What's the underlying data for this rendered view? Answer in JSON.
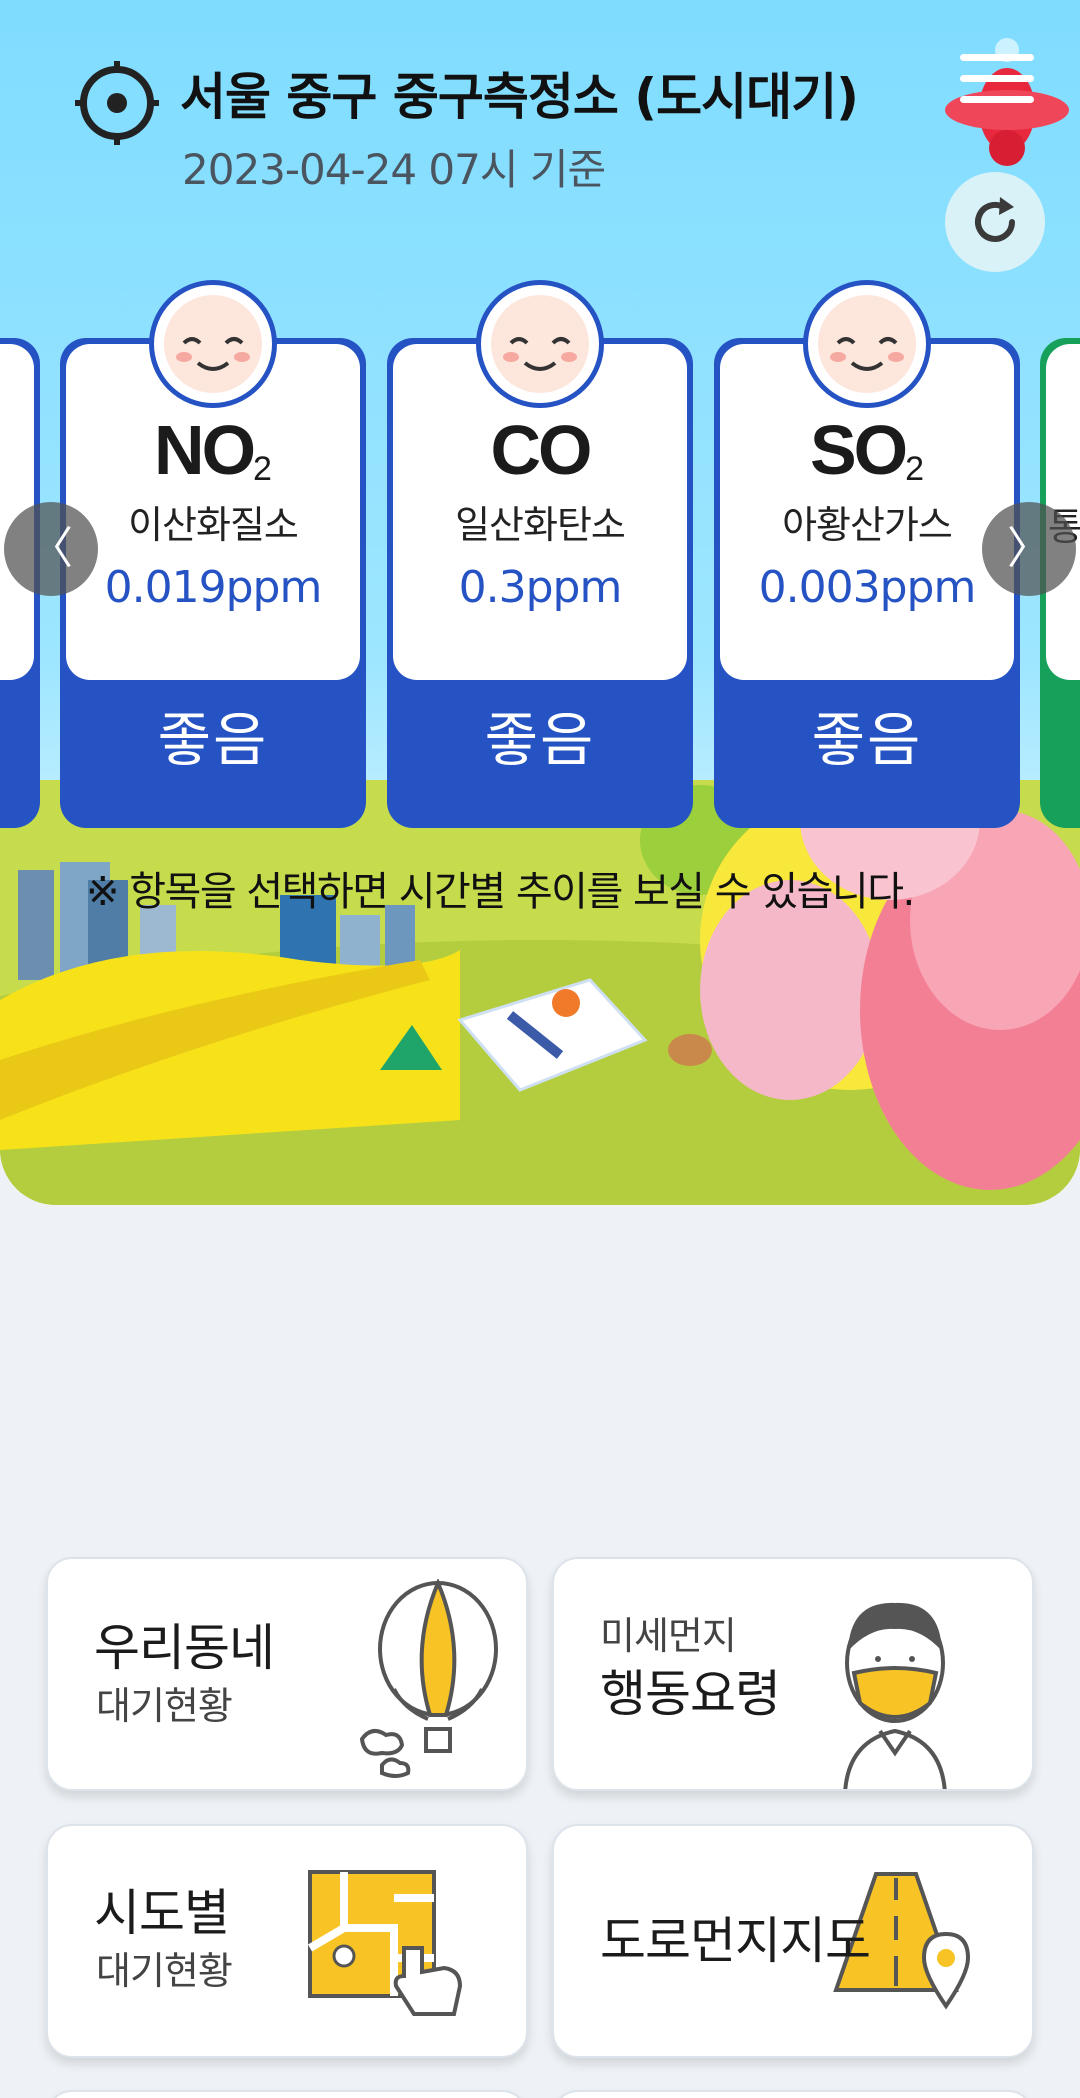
{
  "header": {
    "station_title": "서울 중구 중구측정소 (도시대기)",
    "timestamp": "2023-04-24 07시 기준"
  },
  "icons": {
    "location": "crosshair-icon",
    "menu": "hamburger-menu-icon",
    "refresh": "refresh-icon",
    "prev": "chevron-left-icon",
    "next": "chevron-right-icon"
  },
  "pollutants": [
    {
      "symbol": "NO",
      "sub": "2",
      "name": "이산화질소",
      "value": "0.019ppm",
      "grade": "좋음"
    },
    {
      "symbol": "CO",
      "sub": "",
      "name": "일산화탄소",
      "value": "0.3ppm",
      "grade": "좋음"
    },
    {
      "symbol": "SO",
      "sub": "2",
      "name": "아황산가스",
      "value": "0.003ppm",
      "grade": "좋음"
    }
  ],
  "nav": {
    "prev": "〈",
    "next": "〉",
    "peek_right": "통"
  },
  "colors": {
    "good": "#2553c4",
    "next_card": "#16a05a",
    "sky": "#7fdcff"
  },
  "hint": "※ 항목을 선택하면 시간별 추이를 보실 수 있습니다.",
  "tiles": {
    "neighborhood": {
      "title": "우리동네",
      "subtitle": "대기현황"
    },
    "guide": {
      "subtitle": "미세먼지",
      "title": "행동요령"
    },
    "province": {
      "title": "시도별",
      "subtitle": "대기현황"
    },
    "road": {
      "title": "도로먼지지도"
    }
  }
}
